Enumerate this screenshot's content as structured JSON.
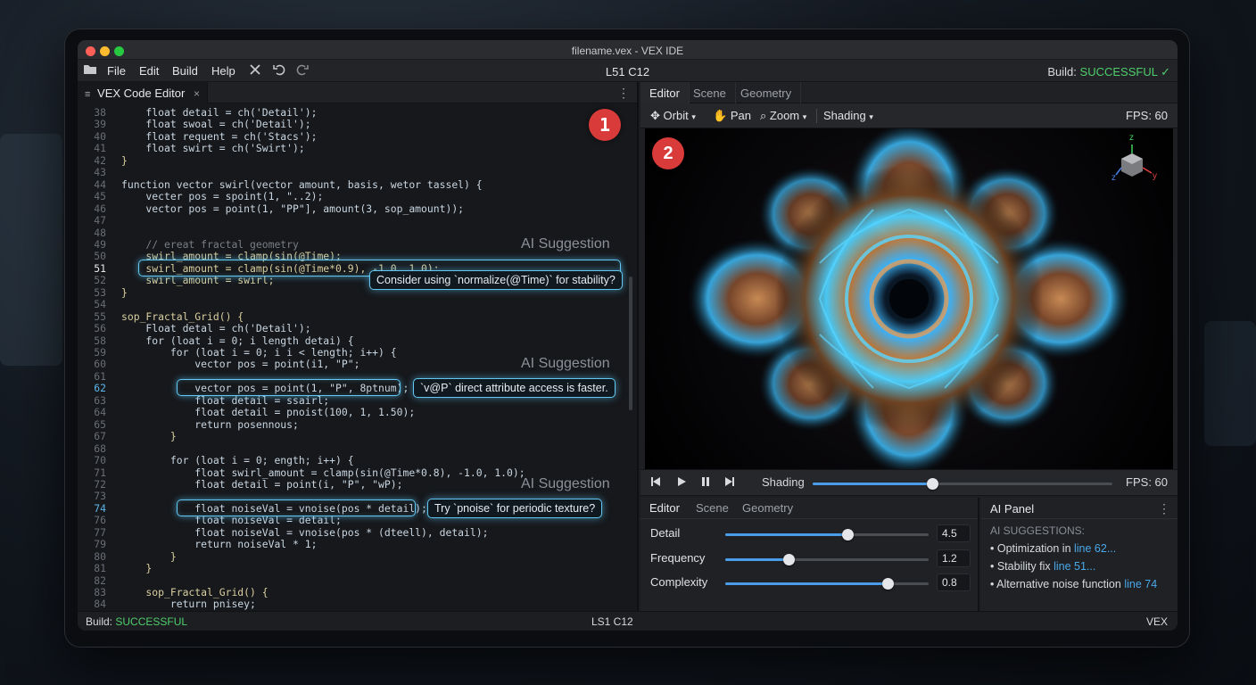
{
  "window": {
    "title": "filename.vex - VEX IDE"
  },
  "menubar": {
    "items": [
      "File",
      "Edit",
      "Build",
      "Help"
    ],
    "cursor": "L51 C12",
    "build_label": "Build:",
    "build_status": "SUCCESSFUL",
    "build_check": "✓"
  },
  "editor": {
    "tab_label": "VEX Code Editor",
    "tab_close": "×",
    "kebab": "⋮",
    "badge": "1",
    "lines": [
      {
        "n": "38",
        "t": "    float detail = ch('Detail');"
      },
      {
        "n": "39",
        "t": "    float swoal = ch('Detail');"
      },
      {
        "n": "40",
        "t": "    float requent = ch('Stacs');"
      },
      {
        "n": "41",
        "t": "    float swirt = ch('Swirt');"
      },
      {
        "n": "42",
        "t": "}"
      },
      {
        "n": "43",
        "t": ""
      },
      {
        "n": "44",
        "t": "function vector swirl(vector amount, basis, wetor tassel) {"
      },
      {
        "n": "45",
        "t": "    vecter pos = spoint(1, \"..2);"
      },
      {
        "n": "46",
        "t": "    vector pos = point(1, \"PP\"], amount(3, sop_amount));"
      },
      {
        "n": "47",
        "t": ""
      },
      {
        "n": "48",
        "t": ""
      },
      {
        "n": "49",
        "t": "    // ereat fractal geometry"
      },
      {
        "n": "50",
        "t": "    swirl_amount = clamp(sin(@Time);"
      },
      {
        "n": "51",
        "t": "    swirl_amount = clamp(sin(@Time*0.9), -1.0, 1.0);"
      },
      {
        "n": "52",
        "t": "    swirl_amount = swirl;"
      },
      {
        "n": "53",
        "t": "}"
      },
      {
        "n": "54",
        "t": ""
      },
      {
        "n": "55",
        "t": "sop_Fractal_Grid() {"
      },
      {
        "n": "56",
        "t": "    Float detal = ch('Detail');"
      },
      {
        "n": "58",
        "t": "    for (loat i = 0; i length detai) {"
      },
      {
        "n": "59",
        "t": "        for (loat i = 0; i i < length; i++) {"
      },
      {
        "n": "60",
        "t": "            vector pos = point(i1, \"P\";"
      },
      {
        "n": "61",
        "t": ""
      },
      {
        "n": "62",
        "t": "            vector pos = point(1, \"P\", 8ptnum);"
      },
      {
        "n": "63",
        "t": "            float detail = ssairl;"
      },
      {
        "n": "64",
        "t": "            float detail = pnoist(100, 1, 1.50);"
      },
      {
        "n": "65",
        "t": "            return posennous;"
      },
      {
        "n": "67",
        "t": "        }"
      },
      {
        "n": "68",
        "t": ""
      },
      {
        "n": "70",
        "t": "        for (loat i = 0; ength; i++) {"
      },
      {
        "n": "71",
        "t": "            float swirl_amount = clamp(sin(@Time*0.8), -1.0, 1.0);"
      },
      {
        "n": "72",
        "t": "            float detail = point(i, \"P\", \"wP);"
      },
      {
        "n": "73",
        "t": ""
      },
      {
        "n": "74",
        "t": "            float noiseVal = vnoise(pos * detail);"
      },
      {
        "n": "76",
        "t": "            float noiseVal = detail;"
      },
      {
        "n": "77",
        "t": "            float noiseVal = vnoise(pos * (dteell), detail);"
      },
      {
        "n": "79",
        "t": "            return noiseVal * 1;"
      },
      {
        "n": "80",
        "t": "        }"
      },
      {
        "n": "81",
        "t": "    }"
      },
      {
        "n": "82",
        "t": ""
      },
      {
        "n": "83",
        "t": "    sop_Fractal_Grid() {"
      },
      {
        "n": "84",
        "t": "        return pnisey;"
      }
    ],
    "suggestions": [
      {
        "label": "AI Suggestion",
        "tip": "Consider using `normalize(@Time)` for stability?"
      },
      {
        "label": "AI Suggestion",
        "tip": "`v@P` direct attribute access is faster."
      },
      {
        "label": "AI Suggestion",
        "tip": "Try `pnoise` for periodic texture?"
      }
    ]
  },
  "viewer": {
    "tabs": [
      "Editor",
      "Scene",
      "Geometry"
    ],
    "tools": {
      "orbit": "Orbit",
      "pan": "Pan",
      "zoom": "Zoom",
      "shading": "Shading"
    },
    "fps": "FPS: 60",
    "badge": "2",
    "axes": {
      "z": "z",
      "y": "y",
      "x": "z"
    },
    "playbar": {
      "shading": "Shading",
      "fps": "FPS: 60",
      "progress": 0.4
    }
  },
  "properties": {
    "tabs": [
      "Editor",
      "Scene",
      "Geometry"
    ],
    "params": [
      {
        "label": "Detail",
        "value": "4.5",
        "level": 0.6
      },
      {
        "label": "Frequency",
        "value": "1.2",
        "level": 0.31
      },
      {
        "label": "Complexity",
        "value": "0.8",
        "level": 0.8
      }
    ]
  },
  "ai_panel": {
    "title": "AI Panel",
    "kebab": "⋮",
    "heading": "AI SUGGESTIONS:",
    "items": [
      {
        "text": "• Optimization in ",
        "link": "line 62..."
      },
      {
        "text": "• Stability fix ",
        "link": "line 51..."
      },
      {
        "text": "• Alternative noise function ",
        "link": "line 74"
      }
    ]
  },
  "status": {
    "build_label": "Build:",
    "build_status": "SUCCESSFUL",
    "cursor": "LS1 C12",
    "language": "VEX"
  },
  "colors": {
    "accent": "#4a9de8",
    "success": "#4fcf6b",
    "suggestion_glow": "#62c8f2",
    "badge": "#d93a3a"
  }
}
